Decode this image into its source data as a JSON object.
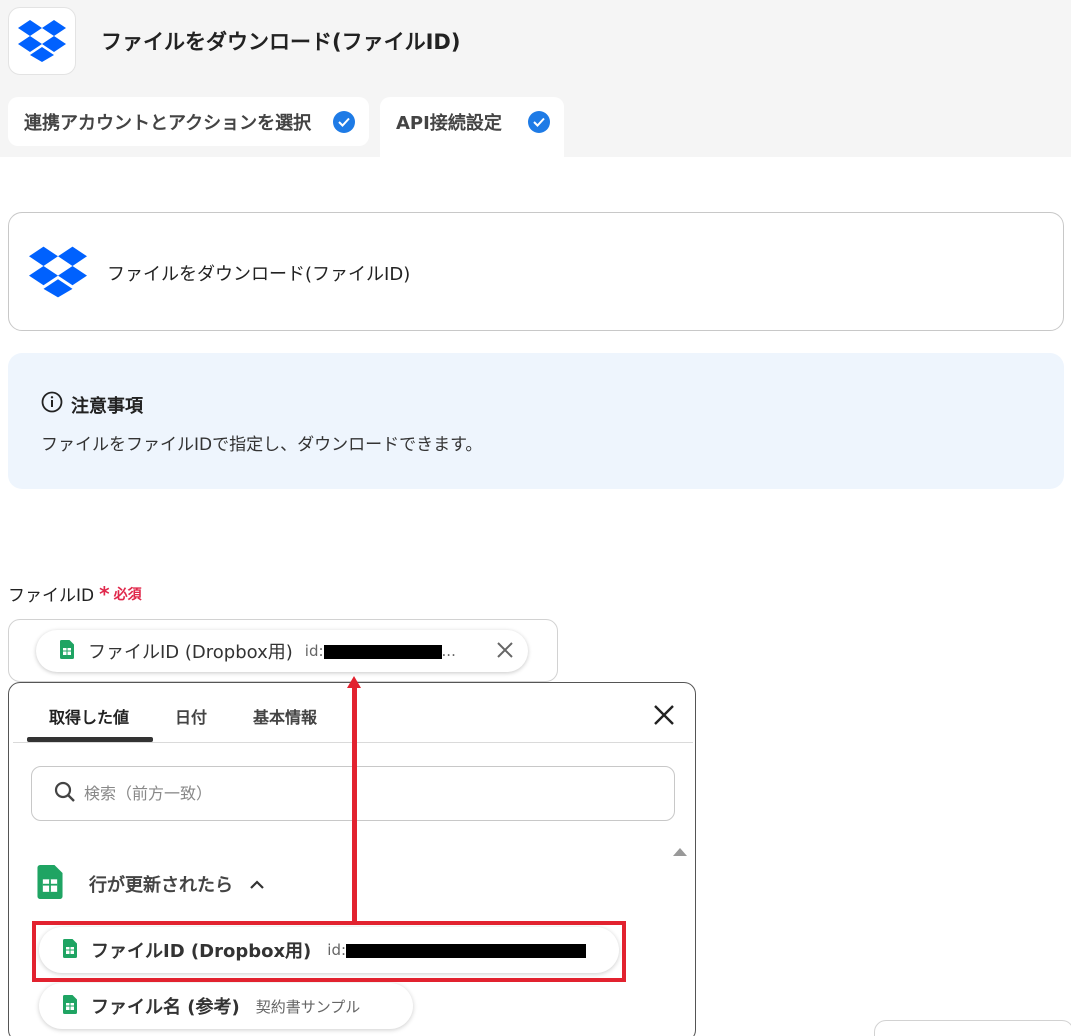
{
  "header": {
    "title": "ファイルをダウンロード(ファイルID)",
    "tabs": [
      {
        "label": "連携アカウントとアクションを選択",
        "done": true
      },
      {
        "label": "API接続設定",
        "done": true
      }
    ]
  },
  "action_card": {
    "label": "ファイルをダウンロード(ファイルID)"
  },
  "notice": {
    "title": "注意事項",
    "body": "ファイルをファイルIDで指定し、ダウンロードできます。"
  },
  "field": {
    "label": "ファイルID",
    "required_mark": "*",
    "required_text": "必須",
    "chip": {
      "name": "ファイルID (Dropbox用)",
      "value_prefix": "id:",
      "ellipsis": "..."
    }
  },
  "picker": {
    "tabs": [
      "取得した値",
      "日付",
      "基本情報"
    ],
    "active_tab": "取得した値",
    "search_placeholder": "検索（前方一致）",
    "group": {
      "name": "行が更新されたら",
      "items": [
        {
          "name": "ファイルID (Dropbox用)",
          "value": "id:"
        },
        {
          "name": "ファイル名 (参考)",
          "value": "契約書サンプル"
        }
      ]
    }
  },
  "colors": {
    "accent_blue": "#1e7be6",
    "dropbox_blue": "#0061fe",
    "sheets_green": "#1fa463",
    "required_red": "#e0284b",
    "annotation_red": "#e2222f",
    "notice_bg": "#eef5fd"
  },
  "icons": {
    "app": "dropbox-icon",
    "sheets": "google-sheets-icon",
    "info": "info-icon",
    "close": "close-icon",
    "search": "search-icon",
    "check": "check-circle-icon"
  }
}
